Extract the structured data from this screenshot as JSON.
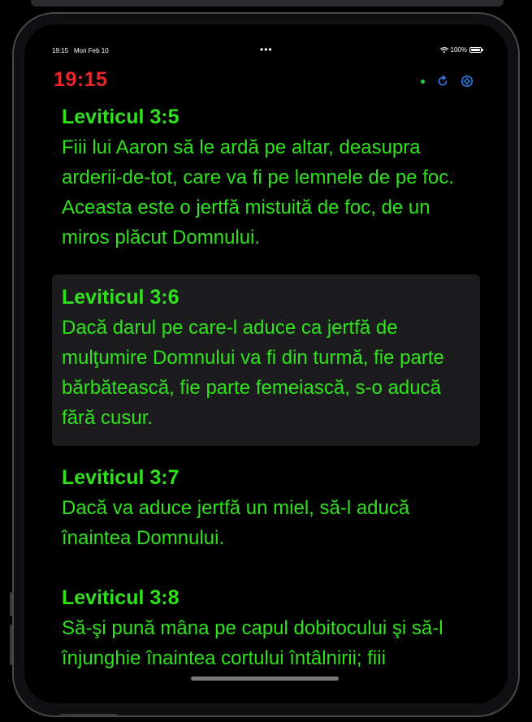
{
  "status_bar": {
    "time": "19:15",
    "date": "Mon Feb 10",
    "dots": "•••",
    "battery": "100%"
  },
  "header": {
    "clock": "19:15",
    "clock_color": "#e8252a",
    "icons": [
      "status-dot",
      "refresh-icon",
      "settings-icon"
    ]
  },
  "verses": [
    {
      "ref": "Leviticul 3:5",
      "text": "Fiii lui Aaron să le ardă pe altar, deasupra arderii-de-tot, care va fi pe lemnele de pe foc. Aceasta este o jertfă mistuită de foc, de un miros plăcut Domnului.",
      "highlighted": false
    },
    {
      "ref": "Leviticul 3:6",
      "text": "Dacă darul pe care-l aduce ca jertfă de mulţumire Domnului va fi din turmă, fie parte bărbătească, fie parte femeiască, s-o aducă fără cusur.",
      "highlighted": true
    },
    {
      "ref": "Leviticul 3:7",
      "text": "Dacă va aduce jertfă un miel, să-l aducă înaintea Domnului.",
      "highlighted": false
    },
    {
      "ref": "Leviticul 3:8",
      "text": "Să-şi pună mâna pe capul dobitocului şi să-l înjunghie înaintea cortului întâlnirii; fiii",
      "highlighted": false
    }
  ],
  "colors": {
    "verse_text": "#30e21c",
    "accent_blue": "#2f80ed",
    "highlight_bg": "#1c1c1e"
  }
}
